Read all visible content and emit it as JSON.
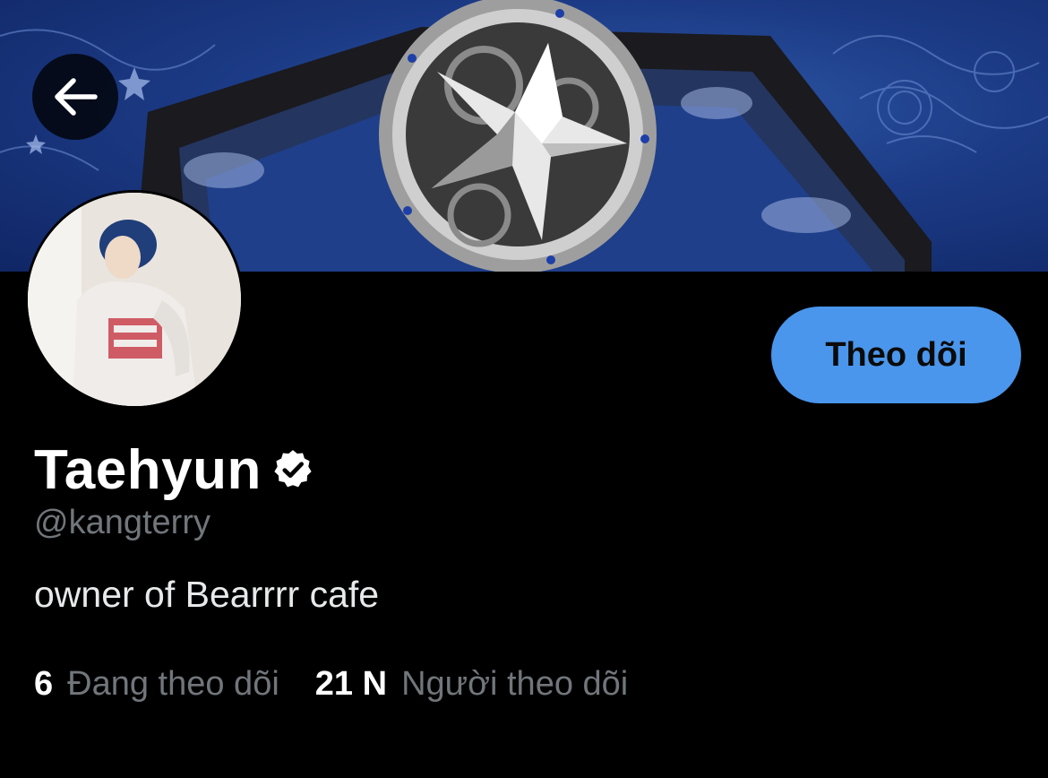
{
  "header": {
    "back_icon": "arrow-left-icon"
  },
  "profile": {
    "display_name": "Taehyun",
    "verified_icon": "verified-badge-icon",
    "username": "@kangterry",
    "bio": "owner of Bearrrr cafe",
    "follow_label": "Theo dõi"
  },
  "stats": {
    "following_count": "6",
    "following_label": "Đang theo dõi",
    "followers_count": "21 N",
    "followers_label": "Người theo dõi"
  },
  "colors": {
    "background": "#000000",
    "follow_button": "#4a96ec",
    "muted_text": "#71767b",
    "banner_blue": "#1c3b86"
  }
}
